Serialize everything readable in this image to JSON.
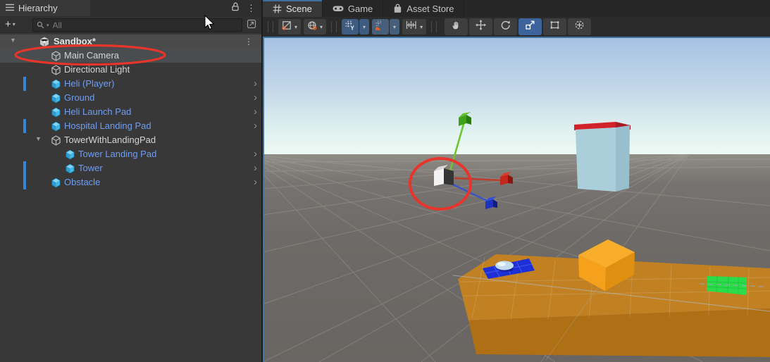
{
  "hierarchy": {
    "tab": "Hierarchy",
    "search": {
      "placeholder": "All"
    },
    "scene_row": {
      "name": "Sandbox*"
    },
    "items": [
      {
        "label": "Main Camera",
        "kind": "default",
        "depth": 0,
        "selected": true,
        "circled": true
      },
      {
        "label": "Directional Light",
        "kind": "default",
        "depth": 0
      },
      {
        "label": "Heli (Player)",
        "kind": "prefab",
        "depth": 0,
        "chevron": true,
        "modified": true
      },
      {
        "label": "Ground",
        "kind": "prefab",
        "depth": 0,
        "chevron": true
      },
      {
        "label": "Heli Launch Pad",
        "kind": "prefab",
        "depth": 0,
        "chevron": true
      },
      {
        "label": "Hospital Landing Pad",
        "kind": "prefab",
        "depth": 0,
        "chevron": true,
        "modified": true
      },
      {
        "label": "TowerWithLandingPad",
        "kind": "default",
        "depth": 0,
        "expanded": true
      },
      {
        "label": "Tower Landing Pad",
        "kind": "prefab",
        "depth": 1,
        "chevron": true
      },
      {
        "label": "Tower",
        "kind": "prefab",
        "depth": 1,
        "chevron": true,
        "modified": true
      },
      {
        "label": "Obstacle",
        "kind": "prefab",
        "depth": 0,
        "chevron": true,
        "modified": true
      }
    ]
  },
  "scene_panel": {
    "tabs": [
      {
        "label": "Scene",
        "icon": "grid-icon",
        "active": true
      },
      {
        "label": "Game",
        "icon": "gamepad-icon",
        "active": false
      },
      {
        "label": "Asset Store",
        "icon": "bag-icon",
        "active": false
      }
    ]
  },
  "colors": {
    "panel": "#383838",
    "header": "#2d2d2d",
    "tabbar": "#262626",
    "text": "#d4d4d4",
    "prefab_text": "#6f9df2",
    "selection": "#4a4d50",
    "row_alt": "#4a4a4a",
    "modified_bar": "#3585d6",
    "focus_outline": "#3f74a3",
    "button": "#3e3e3e",
    "button_active": "#3c639c",
    "grid_btn": "#3d5c80",
    "snap_btn": "#46607b",
    "icon_blue": "#45b8ea",
    "icon_blue_light": "#7fd4f5",
    "icon_blue_dark": "#2d9cd0",
    "sky_top": "#a6c2e3",
    "sky_horizon": "#eefaf4",
    "ground": "#6e6a67",
    "ground_far": "#8f8d86",
    "slab_top": "#c6831f",
    "slab_front": "#b27013",
    "cube_top": "#f9ae2b",
    "cube_front": "#f5a11c",
    "cube_right": "#df9010",
    "tower_front": "#abcedb",
    "tower_side": "#97bfcd",
    "tower_rim": "#d2232b",
    "pad_blue": "#1d2fd6",
    "pad_green": "#2bdc4a",
    "heli_body": "#c2dcee",
    "gizmo_green": "#6fc431",
    "gizmo_red": "#bf3b2b",
    "gizmo_blue": "#3a55c4",
    "annotation": "#e8352b"
  }
}
